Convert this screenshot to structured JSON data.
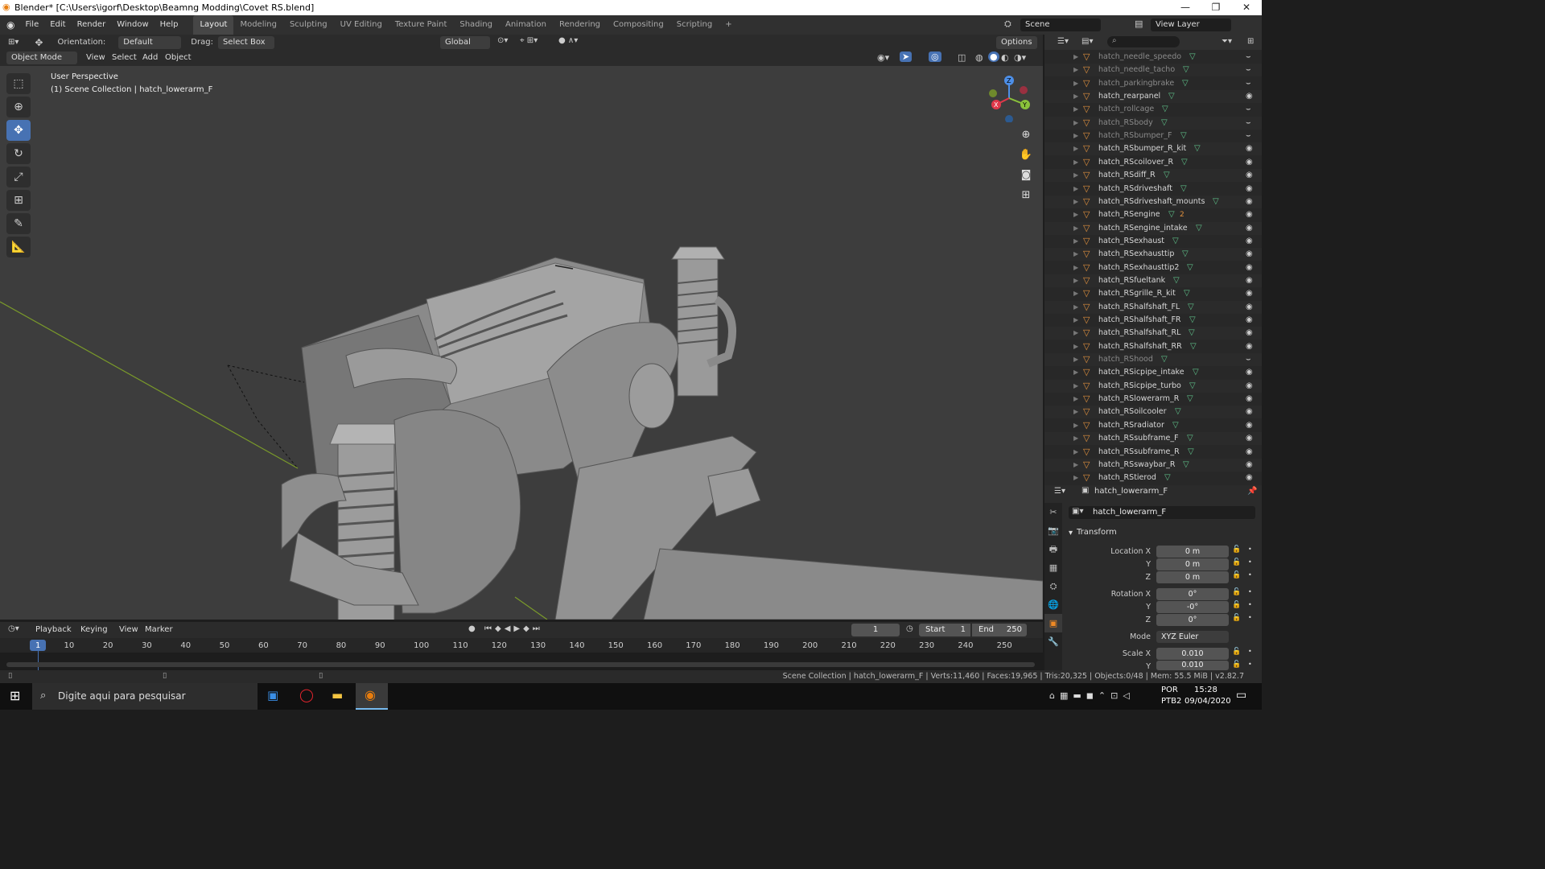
{
  "window": {
    "title": "Blender* [C:\\Users\\igorf\\Desktop\\Beamng Modding\\Covet RS.blend]"
  },
  "menu": [
    "File",
    "Edit",
    "Render",
    "Window",
    "Help"
  ],
  "workspaces": [
    "Layout",
    "Modeling",
    "Sculpting",
    "UV Editing",
    "Texture Paint",
    "Shading",
    "Animation",
    "Rendering",
    "Compositing",
    "Scripting",
    "+"
  ],
  "scene": {
    "name": "Scene",
    "view_layer": "View Layer"
  },
  "viewport_header": {
    "orientation_label": "Orientation:",
    "orientation_value": "Default",
    "drag_label": "Drag:",
    "drag_value": "Select Box",
    "transform_space": "Global",
    "options": "Options",
    "mode": "Object Mode",
    "menus": [
      "View",
      "Select",
      "Add",
      "Object"
    ]
  },
  "viewport": {
    "perspective": "User Perspective",
    "collection_info": "(1) Scene Collection | hatch_lowerarm_F",
    "gizmo_axes": [
      "Z",
      "Y",
      "X"
    ]
  },
  "outliner": {
    "items": [
      {
        "name": "hatch_needle_speedo",
        "visible": false
      },
      {
        "name": "hatch_needle_tacho",
        "visible": false
      },
      {
        "name": "hatch_parkingbrake",
        "visible": false
      },
      {
        "name": "hatch_rearpanel",
        "visible": true
      },
      {
        "name": "hatch_rollcage",
        "visible": false
      },
      {
        "name": "hatch_RSbody",
        "visible": false
      },
      {
        "name": "hatch_RSbumper_F",
        "visible": false
      },
      {
        "name": "hatch_RSbumper_R_kit",
        "visible": true
      },
      {
        "name": "hatch_RScoilover_R",
        "visible": true
      },
      {
        "name": "hatch_RSdiff_R",
        "visible": true
      },
      {
        "name": "hatch_RSdriveshaft",
        "visible": true
      },
      {
        "name": "hatch_RSdriveshaft_mounts",
        "visible": true
      },
      {
        "name": "hatch_RSengine",
        "visible": true
      },
      {
        "name": "hatch_RSengine_intake",
        "visible": true
      },
      {
        "name": "hatch_RSexhaust",
        "visible": true
      },
      {
        "name": "hatch_RSexhausttip",
        "visible": true
      },
      {
        "name": "hatch_RSexhausttip2",
        "visible": true
      },
      {
        "name": "hatch_RSfueltank",
        "visible": true
      },
      {
        "name": "hatch_RSgrille_R_kit",
        "visible": true
      },
      {
        "name": "hatch_RShalfshaft_FL",
        "visible": true
      },
      {
        "name": "hatch_RShalfshaft_FR",
        "visible": true
      },
      {
        "name": "hatch_RShalfshaft_RL",
        "visible": true
      },
      {
        "name": "hatch_RShalfshaft_RR",
        "visible": true
      },
      {
        "name": "hatch_RShood",
        "visible": false
      },
      {
        "name": "hatch_RSicpipe_intake",
        "visible": true
      },
      {
        "name": "hatch_RSicpipe_turbo",
        "visible": true
      },
      {
        "name": "hatch_RSlowerarm_R",
        "visible": true
      },
      {
        "name": "hatch_RSoilcooler",
        "visible": true
      },
      {
        "name": "hatch_RSradiator",
        "visible": true
      },
      {
        "name": "hatch_RSsubframe_F",
        "visible": true
      },
      {
        "name": "hatch_RSsubframe_R",
        "visible": true
      },
      {
        "name": "hatch_RSswaybar_R",
        "visible": true
      },
      {
        "name": "hatch_RStierod",
        "visible": true
      }
    ],
    "engine_badge": "2"
  },
  "properties": {
    "object_name_header": "hatch_lowerarm_F",
    "object_name": "hatch_lowerarm_F",
    "panel": "Transform",
    "location_x_label": "Location X",
    "location_y_label": "Y",
    "location_z_label": "Z",
    "location_x": "0 m",
    "location_y": "0 m",
    "location_z": "0 m",
    "rotation_x_label": "Rotation X",
    "rotation_y_label": "Y",
    "rotation_z_label": "Z",
    "rotation_x": "0°",
    "rotation_y": "-0°",
    "rotation_z": "0°",
    "mode_label": "Mode",
    "mode_value": "XYZ Euler",
    "scale_x_label": "Scale X",
    "scale_y_label": "Y",
    "scale_x": "0.010",
    "scale_y": "0.010"
  },
  "timeline": {
    "menus": [
      "Playback",
      "Keying",
      "View",
      "Marker"
    ],
    "current_frame": "1",
    "start_label": "Start",
    "start": "1",
    "end_label": "End",
    "end": "250",
    "ticks": [
      "1",
      "10",
      "20",
      "30",
      "40",
      "50",
      "60",
      "70",
      "80",
      "90",
      "100",
      "110",
      "120",
      "130",
      "140",
      "150",
      "160",
      "170",
      "180",
      "190",
      "200",
      "210",
      "220",
      "230",
      "240",
      "250"
    ]
  },
  "status": "Scene Collection | hatch_lowerarm_F | Verts:11,460 | Faces:19,965 | Tris:20,325 | Objects:0/48 | Mem: 55.5 MiB | v2.82.7",
  "taskbar": {
    "search_placeholder": "Digite aqui para pesquisar",
    "lang1": "POR",
    "lang2": "PTB2",
    "time": "15:28",
    "date": "09/04/2020"
  },
  "colors": {
    "accent": "#4772b3",
    "header": "#303030",
    "viewport": "#3d3d3d",
    "mesh_icon": "#e0903e"
  }
}
